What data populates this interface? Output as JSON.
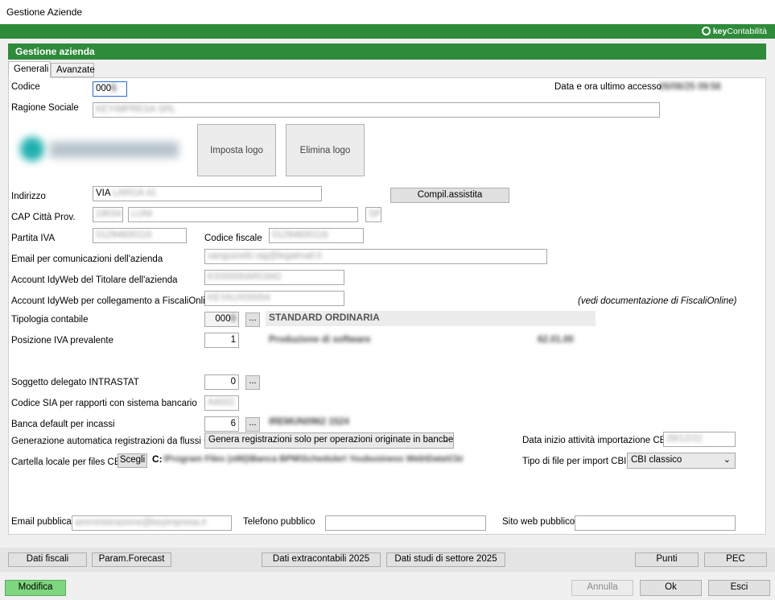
{
  "window": {
    "title": "Gestione Aziende"
  },
  "brand": {
    "name_bold": "key",
    "name_rest": "Contabilità"
  },
  "panel": {
    "title": "Gestione azienda"
  },
  "tabs": [
    {
      "label": "Generali"
    },
    {
      "label": "Avanzate"
    }
  ],
  "form": {
    "codice": {
      "label": "Codice",
      "value": "000"
    },
    "ultimo_accesso": {
      "label": "Data e ora ultimo accesso",
      "value": "26/06/25  09:56"
    },
    "ragione_sociale": {
      "label": "Ragione Sociale",
      "value": "KEYIMPRESA SRL"
    },
    "logo": {
      "set_label": "Imposta logo",
      "delete_label": "Elimina logo"
    },
    "indirizzo": {
      "label": "Indirizzo",
      "value": "VIA",
      "value_blur": "LARGA 41",
      "button_label": "Compil.assistita"
    },
    "cap_citta": {
      "label": "CAP Città   Prov.",
      "cap": "19034",
      "citta": "LUNI",
      "prov": "SP"
    },
    "partita_iva": {
      "label": "Partita IVA",
      "value": "01294600116"
    },
    "codice_fiscale": {
      "label": "Codice fiscale",
      "value": "01294600116"
    },
    "email_comunicazioni": {
      "label": "Email per comunicazioni dell'azienda",
      "value": "sanguinetti.rag@legalmail.it"
    },
    "account_titolare": {
      "label": "Account IdyWeb del Titolare dell'azienda",
      "value": "KX00000ARG942"
    },
    "account_fiscalionline": {
      "label": "Account IdyWeb per collegamento a FiscaliOnline",
      "value": "KEYAUX00054"
    },
    "vedi_doc": {
      "text": "(vedi documentazione di FiscaliOnline)"
    },
    "tipologia_contabile": {
      "label": "Tipologia contabile",
      "value": "000",
      "description": "STANDARD ORDINARIA"
    },
    "posizione_iva": {
      "label": "Posizione IVA prevalente",
      "value": "1",
      "description": "Produzione di software",
      "code": "62.01.00"
    },
    "intrastat": {
      "label": "Soggetto delegato INTRASTAT",
      "value": "0"
    },
    "codice_sia": {
      "label": "Codice SIA per rapporti con sistema bancario",
      "value": "A4002"
    },
    "banca_default": {
      "label": "Banca default per incassi",
      "value": "6",
      "description": "IREMUN0962 1524"
    },
    "generazione_cbi": {
      "label": "Generazione automatica registrazioni da flussi CBI",
      "selected": "Genera registrazioni solo per operazioni originate in banche"
    },
    "data_inizio_cbi": {
      "label": "Data inizio attività importazione CBI",
      "value": "28/12/22"
    },
    "cartella_cbi": {
      "label": "Cartella locale per files CBI",
      "button_label": "Scegli",
      "drive": "C:",
      "path": "\\Program Files (x86)\\Banca BPM\\Scheduler\\ Youbusiness Web\\Data\\Cbi"
    },
    "tipo_file_cbi": {
      "label": "Tipo di file per import CBI",
      "selected": "CBI classico"
    },
    "email_pubblica": {
      "label": "Email pubblica",
      "value": "amministrazione@keyimpresa.it"
    },
    "telefono_pubblico": {
      "label": "Telefono pubblico",
      "value": ""
    },
    "sito_web": {
      "label": "Sito web pubblico",
      "value": ""
    }
  },
  "footer": {
    "dati_fiscali": "Dati fiscali",
    "param_forecast": "Param.Forecast",
    "dati_extracontabili": "Dati extracontabili 2025",
    "dati_studi": "Dati studi di settore 2025",
    "punti": "Punti",
    "pec": "PEC"
  },
  "bottom": {
    "modifica": "Modifica",
    "annulla": "Annulla",
    "ok": "Ok",
    "esci": "Esci"
  },
  "colors": {
    "accent_green": "#2e8b3a",
    "modifica_green": "#7ed67e"
  }
}
